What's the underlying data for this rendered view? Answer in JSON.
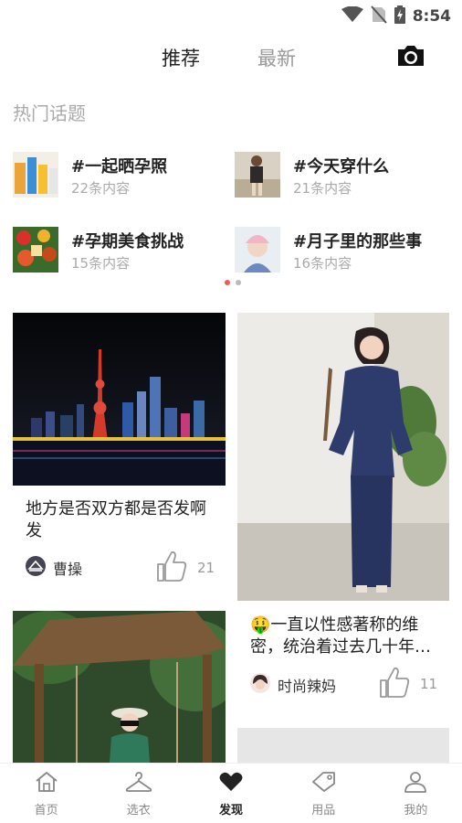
{
  "status_bar": {
    "time": "8:54"
  },
  "header": {
    "tabs": [
      {
        "label": "推荐"
      },
      {
        "label": "最新"
      }
    ],
    "camera_icon": "camera-icon"
  },
  "topics": {
    "title": "热门话题",
    "items": [
      {
        "name": "#一起晒孕照",
        "count": "22条内容"
      },
      {
        "name": "#今天穿什么",
        "count": "21条内容"
      },
      {
        "name": "#孕期美食挑战",
        "count": "15条内容"
      },
      {
        "name": "#月子里的那些事",
        "count": "16条内容"
      }
    ],
    "pager": {
      "total": 2,
      "active": 1
    }
  },
  "feed": {
    "cards": [
      {
        "title": "地方是否双方都是否发啊发",
        "author": "曹操",
        "likes": "21"
      },
      {
        "title": "🤑一直以性感著称的维密，统治着过去几十年…",
        "author": "时尚辣妈",
        "likes": "11"
      }
    ]
  },
  "bottom_nav": {
    "items": [
      {
        "label": "首页",
        "icon": "home-icon"
      },
      {
        "label": "选衣",
        "icon": "hanger-icon"
      },
      {
        "label": "发现",
        "icon": "heart-icon"
      },
      {
        "label": "用品",
        "icon": "tag-icon"
      },
      {
        "label": "我的",
        "icon": "user-icon"
      }
    ],
    "active": "发现"
  },
  "colors": {
    "accent": "#f05a5a",
    "text": "#222222",
    "muted": "#999999"
  }
}
